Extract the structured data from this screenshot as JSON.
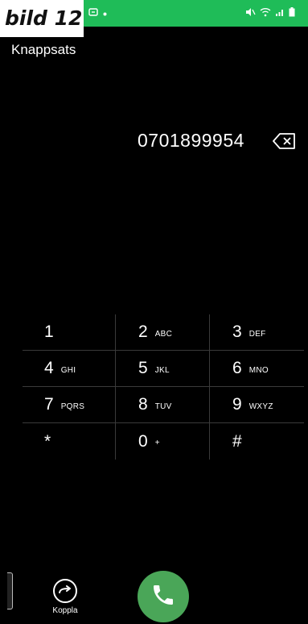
{
  "figure_label": "bild 12",
  "status_bar": {
    "left_icons": [
      "notification-app-icon",
      "dot-icon"
    ],
    "right_icons": [
      "mute-icon",
      "wifi-icon",
      "signal-icon",
      "battery-icon"
    ]
  },
  "title": "Knappsats",
  "dialed_number": "0701899954",
  "keypad": [
    {
      "digit": "1",
      "letters": ""
    },
    {
      "digit": "2",
      "letters": "ABC"
    },
    {
      "digit": "3",
      "letters": "DEF"
    },
    {
      "digit": "4",
      "letters": "GHI"
    },
    {
      "digit": "5",
      "letters": "JKL"
    },
    {
      "digit": "6",
      "letters": "MNO"
    },
    {
      "digit": "7",
      "letters": "PQRS"
    },
    {
      "digit": "8",
      "letters": "TUV"
    },
    {
      "digit": "9",
      "letters": "WXYZ"
    },
    {
      "digit": "*",
      "letters": ""
    },
    {
      "digit": "0",
      "letters": "+"
    },
    {
      "digit": "#",
      "letters": ""
    }
  ],
  "transfer_label": "Koppla",
  "colors": {
    "status_bar": "#1fbc58",
    "call_button": "#4aa658",
    "background": "#000000"
  }
}
